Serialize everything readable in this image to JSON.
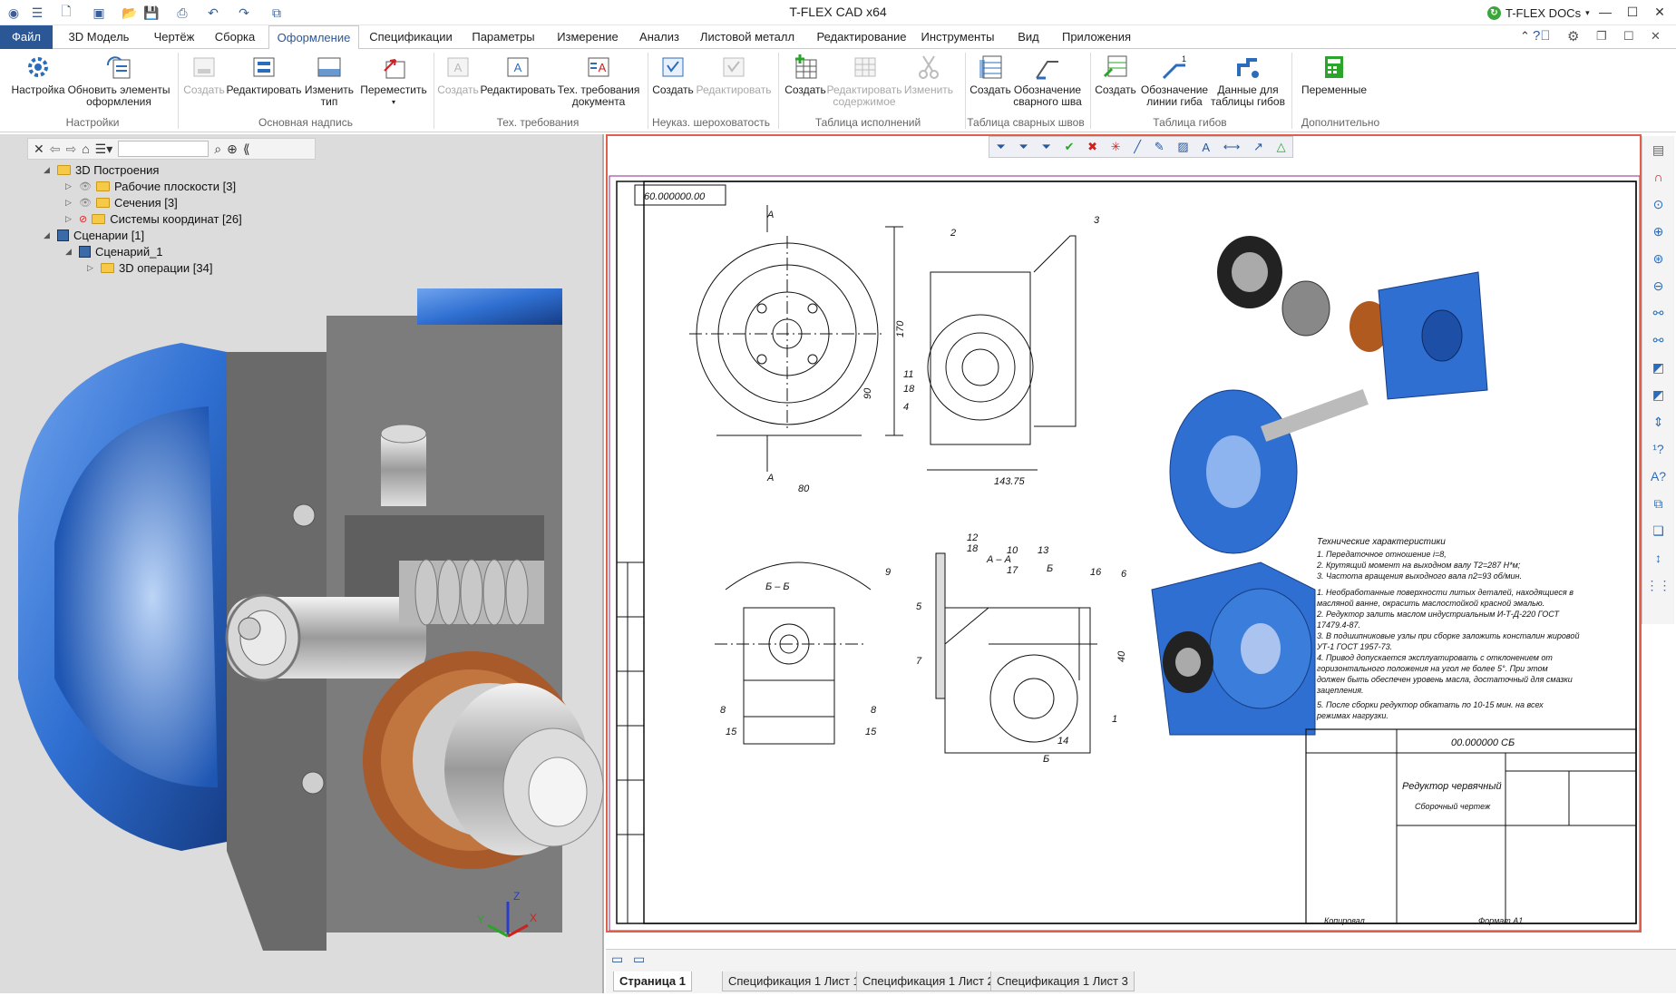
{
  "app": {
    "title": "T-FLEX CAD x64"
  },
  "docs": {
    "label": "T-FLEX DOCs"
  },
  "menu": {
    "file": "Файл",
    "tabs": [
      "3D Модель",
      "Чертёж",
      "Сборка",
      "Оформление",
      "Спецификации",
      "Параметры",
      "Измерение",
      "Анализ",
      "Листовой металл",
      "Редактирование",
      "Инструменты",
      "Вид",
      "Приложения"
    ],
    "active": "Оформление"
  },
  "ribbon": {
    "buttons": {
      "settings": "Настройка",
      "update": "Обновить элементы оформления",
      "tb_create": "Создать",
      "tb_edit": "Редактировать",
      "tb_change_type": "Изменить тип",
      "tb_move": "Переместить",
      "tr_create": "Создать",
      "tr_edit": "Редактировать",
      "tr_doc": "Тех. требования документа",
      "rough_create": "Создать",
      "rough_edit": "Редактировать",
      "tbl_create": "Создать",
      "tbl_edit": "Редактировать содержимое",
      "tbl_change": "Изменить",
      "weld_create": "Создать",
      "weld_mark": "Обозначение сварного шва",
      "bend_create": "Создать",
      "bend_mark": "Обозначение линии гиба",
      "bend_data": "Данные для таблицы гибов",
      "vars": "Переменные"
    },
    "groups": {
      "g1": "Настройки",
      "g2": "Основная надпись",
      "g3": "Тех. требования",
      "g4": "Неуказ. шероховатость",
      "g5": "Таблица исполнений",
      "g6": "Таблица сварных швов",
      "g7": "Таблица гибов",
      "g8": "Дополнительно"
    }
  },
  "tree": {
    "items": [
      {
        "label": "3D Построения"
      },
      {
        "label": "Рабочие плоскости [3]"
      },
      {
        "label": "Сечения [3]"
      },
      {
        "label": "Системы координат [26]"
      },
      {
        "label": "Сценарии [1]"
      },
      {
        "label": "Сценарий_1"
      },
      {
        "label": "3D операции [34]"
      }
    ]
  },
  "axes": {
    "x": "X",
    "y": "Y",
    "z": "Z"
  },
  "drawing": {
    "code_top": "60.000000.00",
    "section_labels": [
      "А",
      "А",
      "Б – Б",
      "А – А",
      "Б",
      "Б"
    ],
    "dims": [
      "170",
      "90",
      "80",
      "143.75",
      "40"
    ],
    "callouts": [
      "2",
      "3",
      "11",
      "18",
      "4",
      "9",
      "8",
      "15",
      "12",
      "18",
      "10",
      "17",
      "13",
      "16",
      "6",
      "5",
      "7",
      "1",
      "14",
      "15",
      "8"
    ],
    "tech_title": "Технические характеристики",
    "tech_lines": [
      "1. Передаточное отношение i=8,",
      "2. Крутящий момент на выходном валу Т2=287 Н*м;",
      "3. Частота вращения выходного вала n2=93 об/мин.",
      "1. Необработанные поверхности литых деталей, находящиеся в",
      "масляной ванне, окрасить маслостойкой красной эмалью.",
      "2. Редуктор залить маслом индустриальным И-Т-Д-220 ГОСТ",
      "17479.4-87.",
      "3. В подшипниковые узлы при сборке заложить консталин жировой",
      "УТ-1 ГОСТ 1957-73.",
      "4. Привод допускается эксплуатировать с отклонением от",
      "горизонтального положения на угол не более 5°. При этом",
      "должен быть обеспечен уровень масла, достаточный для смазки",
      "зацепления.",
      "5. После сборки редуктор обкатать по 10-15 мин. на всех",
      "режимах нагрузки."
    ],
    "stamp": {
      "code": "00.000000 СБ",
      "name": "Редуктор червячный",
      "subname": "Сборочный чертеж",
      "copied": "Копировал",
      "format": "Формат  А1"
    }
  },
  "pages": [
    "Страница 1",
    "Спецификация 1 Лист 1",
    "Спецификация 1 Лист 2",
    "Спецификация 1 Лист 3"
  ],
  "colors": {
    "accent": "#2b5797",
    "model_blue": "#2f6fd1",
    "frame_red": "#e25d4a"
  }
}
